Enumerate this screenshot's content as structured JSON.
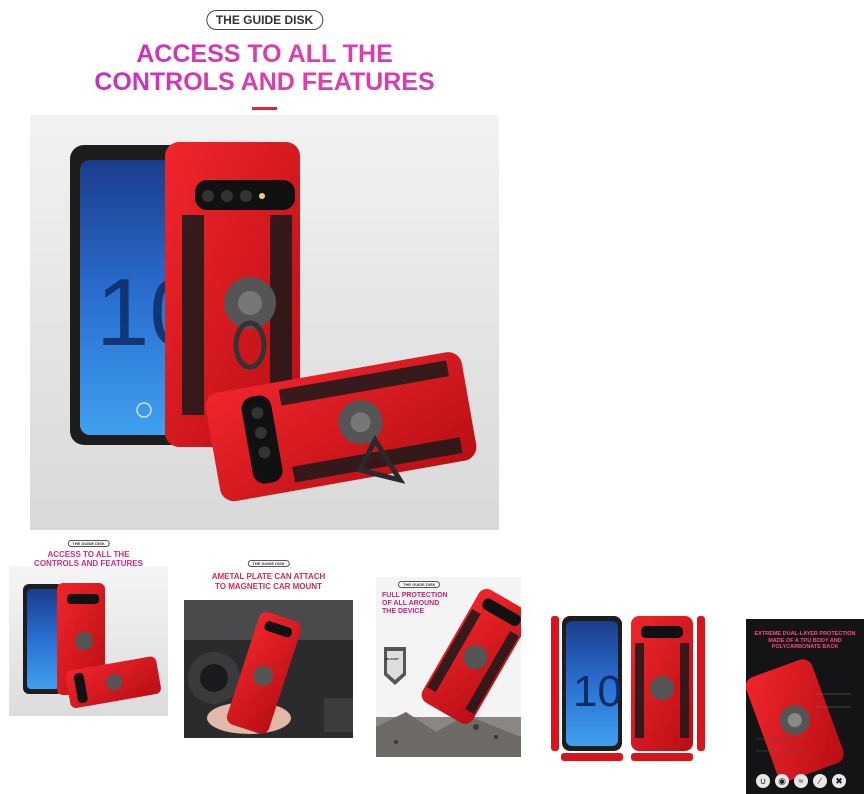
{
  "main": {
    "badge": "THE GUIDE DISK",
    "headline_line1": "ACCESS TO ALL THE",
    "headline_line2": "CONTROLS AND FEATURES"
  },
  "thumbnails": [
    {
      "badge": "THE GUIDE DISK",
      "line1": "ACCESS TO ALL THE",
      "line2": "CONTROLS AND FEATURES"
    },
    {
      "badge": "THE GUIDE DISK",
      "line1": "AMETAL PLATE CAN ATTACH",
      "line2": "TO MAGNETIC CAR MOUNT"
    },
    {
      "badge": "THE GUIDE DISK",
      "line1": "FULL PROTECTION",
      "line2": "OF ALL AROUND",
      "line3": "THE DEVICE",
      "shield": "MILITARY"
    },
    {},
    {
      "line1": "EXTREME DUAL-LAYER PROTECTION",
      "line2": "MADE OF A TPU BODY AND",
      "line3": "POLYCARBONATE BACK"
    }
  ],
  "colors": {
    "case_red": "#d8141c",
    "accent_pink": "#d42a7e",
    "accent_purple": "#b82bd6"
  }
}
